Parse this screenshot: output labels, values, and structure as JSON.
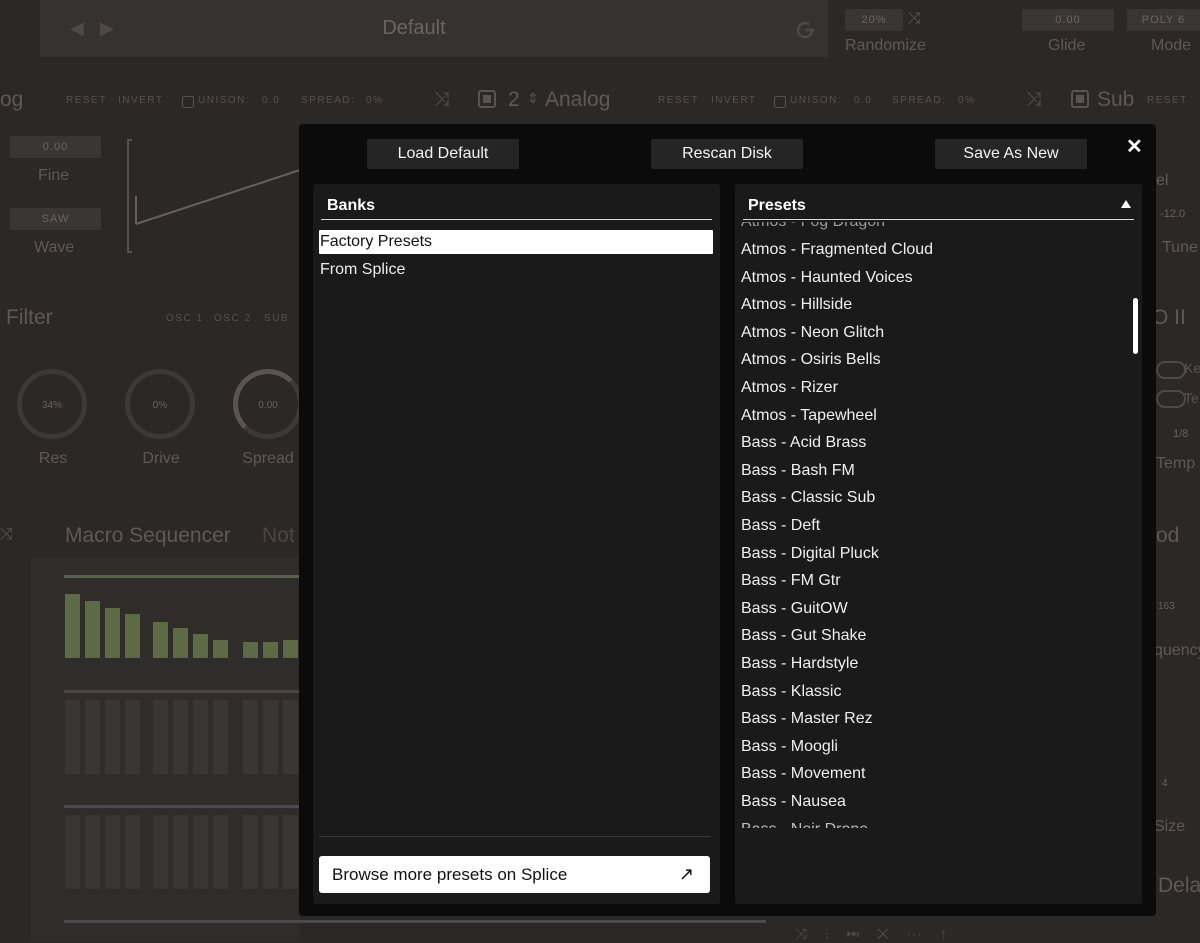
{
  "background": {
    "preset_title": "Default",
    "randomize": {
      "value": "20%",
      "label": "Randomize"
    },
    "glide": {
      "value": "0.00",
      "label": "Glide"
    },
    "mode": {
      "value": "POLY 6",
      "label": "Mode"
    },
    "osc_row_left": {
      "title": "og",
      "reset": "RESET",
      "invert": "INVERT",
      "unison": "UNISON:",
      "unison_val": "0.0",
      "spread": "SPREAD:",
      "spread_val": "0%"
    },
    "osc2": {
      "number": "2",
      "type": "Analog",
      "reset": "RESET",
      "invert": "INVERT",
      "unison": "UNISON:",
      "unison_val": "0.0",
      "spread": "SPREAD:",
      "spread_val": "0%"
    },
    "sub": {
      "title": "Sub",
      "reset": "RESET"
    },
    "fine": {
      "value": "0.00",
      "label": "Fine"
    },
    "wave": {
      "value": "SAW",
      "label": "Wave"
    },
    "right_partial": {
      "label1": "el",
      "value": "-12.0",
      "label2": "Tune",
      "lfo": "O II",
      "key": "Ke",
      "tempo_toggle": "Te",
      "rate": "1/8",
      "tempo": "Temp",
      "mod": "od",
      "knob_val": "163",
      "freq": "quency",
      "num4": "4",
      "size": "Size",
      "delay": "Dela"
    },
    "filter": {
      "title": "Filter",
      "osc1": "OSC 1",
      "osc2": "OSC 2",
      "sub": "SUB"
    },
    "knobs": [
      {
        "value": "34%",
        "label": "Res"
      },
      {
        "value": "0%",
        "label": "Drive"
      },
      {
        "value": "0.00",
        "label": "Spread"
      }
    ],
    "macro": {
      "title": "Macro Sequencer",
      "partial": "Not"
    }
  },
  "modal": {
    "buttons": {
      "load_default": "Load Default",
      "rescan_disk": "Rescan Disk",
      "save_as_new": "Save As New"
    },
    "close_symbol": "✕",
    "banks": {
      "title": "Banks",
      "items": [
        "Factory Presets",
        "From Splice"
      ],
      "selected_index": 0,
      "browse_label": "Browse more presets on Splice",
      "browse_icon": "↗"
    },
    "presets": {
      "title": "Presets",
      "items": [
        "Atmos - Fragmented Cloud",
        "Atmos - Haunted Voices",
        "Atmos - Hillside",
        "Atmos - Neon Glitch",
        "Atmos - Osiris Bells",
        "Atmos - Rizer",
        "Atmos - Tapewheel",
        "Bass - Acid Brass",
        "Bass - Bash FM",
        "Bass - Classic Sub",
        "Bass - Deft",
        "Bass - Digital Pluck",
        "Bass - FM Gtr",
        "Bass - GuitOW",
        "Bass - Gut Shake",
        "Bass - Hardstyle",
        "Bass - Klassic",
        "Bass - Master Rez",
        "Bass - Moogli",
        "Bass - Movement",
        "Bass - Nausea"
      ]
    }
  }
}
